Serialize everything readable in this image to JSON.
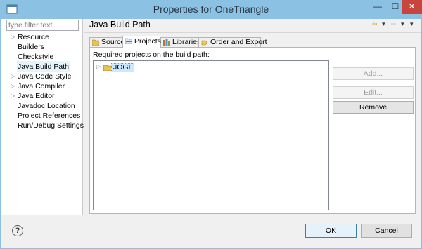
{
  "window": {
    "title": "Properties for OneTriangle",
    "minimize_glyph": "—",
    "maximize_glyph": "☐",
    "close_glyph": "✕"
  },
  "filter": {
    "placeholder": "type filter text"
  },
  "tree": {
    "items": [
      {
        "label": "Resource",
        "expandable": true,
        "selected": false
      },
      {
        "label": "Builders",
        "expandable": false,
        "selected": false
      },
      {
        "label": "Checkstyle",
        "expandable": false,
        "selected": false
      },
      {
        "label": "Java Build Path",
        "expandable": false,
        "selected": true
      },
      {
        "label": "Java Code Style",
        "expandable": true,
        "selected": false
      },
      {
        "label": "Java Compiler",
        "expandable": true,
        "selected": false
      },
      {
        "label": "Java Editor",
        "expandable": true,
        "selected": false
      },
      {
        "label": "Javadoc Location",
        "expandable": false,
        "selected": false
      },
      {
        "label": "Project References",
        "expandable": false,
        "selected": false
      },
      {
        "label": "Run/Debug Settings",
        "expandable": false,
        "selected": false
      }
    ]
  },
  "page": {
    "title": "Java Build Path"
  },
  "tabs": [
    {
      "label": "Source",
      "icon": "source-folder-icon",
      "active": false
    },
    {
      "label": "Projects",
      "icon": "projects-icon",
      "active": true
    },
    {
      "label": "Libraries",
      "icon": "libraries-icon",
      "active": false
    },
    {
      "label": "Order and Export",
      "icon": "order-export-icon",
      "active": false
    }
  ],
  "projects_tab": {
    "list_label": "Required projects on the build path:",
    "projects": [
      {
        "name": "JOGL",
        "icon": "project-folder-icon"
      }
    ],
    "buttons": {
      "add": "Add...",
      "edit": "Edit...",
      "remove": "Remove"
    }
  },
  "footer": {
    "help_glyph": "?",
    "ok": "OK",
    "cancel": "Cancel"
  },
  "colors": {
    "titlebar": "#8bc2e3",
    "close": "#c8453d",
    "selection": "#cce8ff"
  }
}
